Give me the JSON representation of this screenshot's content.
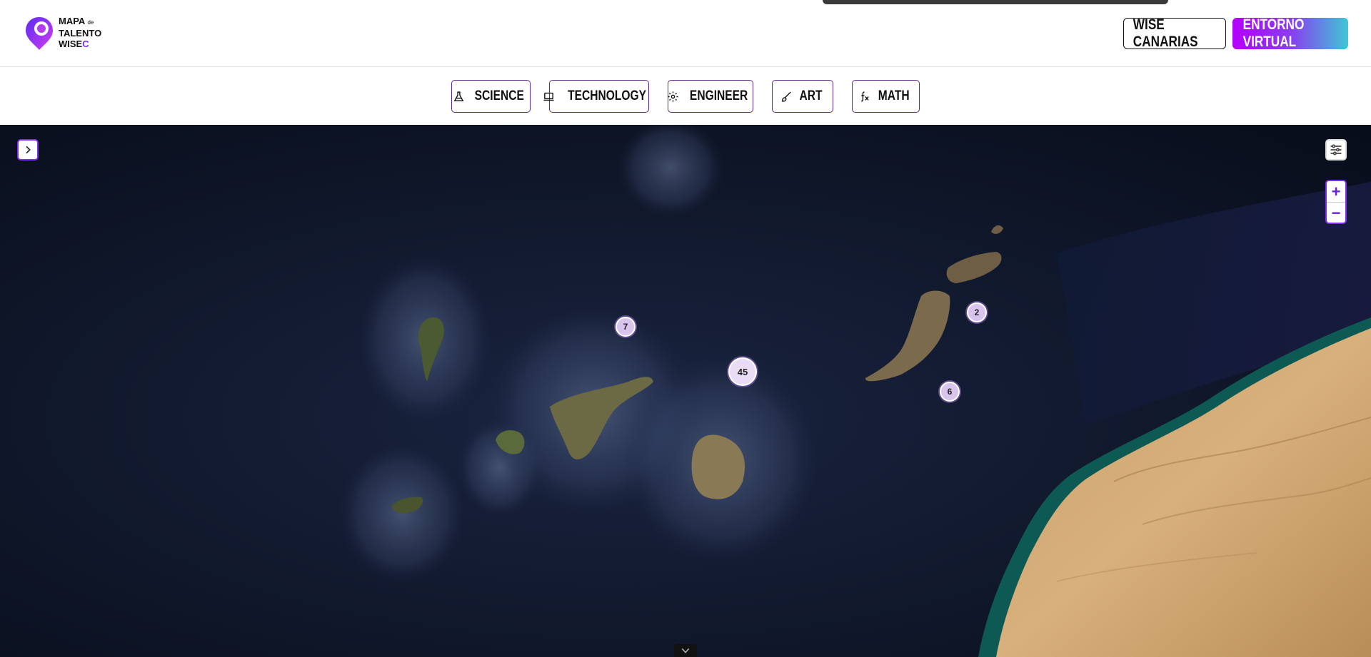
{
  "brand": {
    "line1": "MAPA",
    "de": "de",
    "line2": "TALENTO",
    "line3": "WISE",
    "c": "C",
    "accent": "#7b2cf2"
  },
  "header": {
    "wise_button": "WISE CANARIAS",
    "entorno_button": "ENTORNO VIRTUAL"
  },
  "categories": [
    {
      "label": "SCIENCE",
      "icon": "flask-icon"
    },
    {
      "label": "TECHNOLOGY",
      "icon": "laptop-icon"
    },
    {
      "label": "ENGINEER",
      "icon": "gear-icon"
    },
    {
      "label": "ART",
      "icon": "brush-icon"
    },
    {
      "label": "MATH",
      "icon": "function-icon"
    }
  ],
  "map": {
    "zoom_in": "+",
    "zoom_out": "−",
    "clusters": [
      {
        "count": "2",
        "island": "lanzarote"
      },
      {
        "count": "6",
        "island": "fuerteventura"
      },
      {
        "count": "7",
        "island": "tenerife"
      },
      {
        "count": "45",
        "island": "gran-canaria"
      }
    ]
  }
}
